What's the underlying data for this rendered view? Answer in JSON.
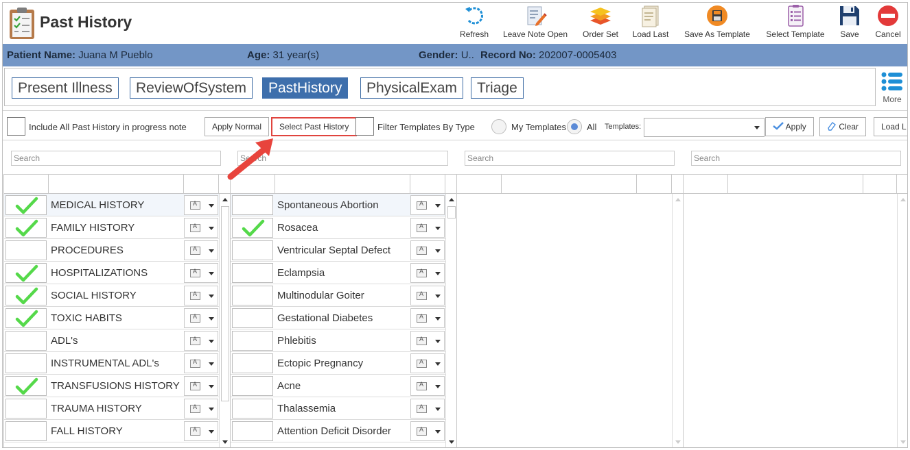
{
  "header": {
    "title": "Past History",
    "toolbar": [
      {
        "id": "refresh",
        "label": "Refresh"
      },
      {
        "id": "leave-note-open",
        "label": "Leave Note Open"
      },
      {
        "id": "order-set",
        "label": "Order Set"
      },
      {
        "id": "load-last",
        "label": "Load Last"
      },
      {
        "id": "save-as-template",
        "label": "Save As Template"
      },
      {
        "id": "select-template",
        "label": "Select Template"
      },
      {
        "id": "save",
        "label": "Save"
      },
      {
        "id": "cancel",
        "label": "Cancel"
      }
    ]
  },
  "patient": {
    "name_label": "Patient Name:",
    "name": "Juana M Pueblo",
    "age_label": "Age:",
    "age": "31 year(s)",
    "gender_label": "Gender:",
    "gender": "U..",
    "record_label": "Record No:",
    "record": "202007-0005403"
  },
  "tabs": [
    {
      "label": "Present Illness",
      "active": false
    },
    {
      "label": "ReviewOfSystem",
      "active": false
    },
    {
      "label": "PastHistory",
      "active": true
    },
    {
      "label": "PhysicalExam",
      "active": false
    },
    {
      "label": "Triage",
      "active": false
    }
  ],
  "more_label": "More",
  "filter": {
    "include_label": "Include All Past History in progress note",
    "apply_normal": "Apply Normal",
    "select_past_history": "Select Past History",
    "filter_by_type": "Filter Templates By Type",
    "my_templates": "My Templates",
    "all": "All",
    "templates_label": "Templates:",
    "templates_value": "",
    "apply": "Apply",
    "clear": "Clear",
    "load": "Load L"
  },
  "search_placeholder": "Search",
  "categories": [
    {
      "label": "MEDICAL HISTORY",
      "checked": true,
      "selected": true
    },
    {
      "label": "FAMILY HISTORY",
      "checked": true
    },
    {
      "label": "PROCEDURES",
      "checked": false
    },
    {
      "label": "HOSPITALIZATIONS",
      "checked": true
    },
    {
      "label": "SOCIAL HISTORY",
      "checked": true
    },
    {
      "label": "TOXIC HABITS",
      "checked": true
    },
    {
      "label": "ADL's",
      "checked": false
    },
    {
      "label": "INSTRUMENTAL ADL's",
      "checked": false
    },
    {
      "label": "TRANSFUSIONS HISTORY",
      "checked": true
    },
    {
      "label": "TRAUMA HISTORY",
      "checked": false
    },
    {
      "label": "FALL HISTORY",
      "checked": false
    }
  ],
  "conditions": [
    {
      "label": "Spontaneous Abortion",
      "checked": false,
      "selected": true
    },
    {
      "label": "Rosacea",
      "checked": true
    },
    {
      "label": "Ventricular Septal Defect",
      "checked": false
    },
    {
      "label": "Eclampsia",
      "checked": false
    },
    {
      "label": "Multinodular Goiter",
      "checked": false
    },
    {
      "label": "Gestational Diabetes",
      "checked": false
    },
    {
      "label": "Phlebitis",
      "checked": false
    },
    {
      "label": "Ectopic Pregnancy",
      "checked": false
    },
    {
      "label": "Acne",
      "checked": false
    },
    {
      "label": "Thalassemia",
      "checked": false
    },
    {
      "label": "Attention Deficit Disorder",
      "checked": false
    }
  ],
  "colors": {
    "patient_bar": "#7396c6",
    "active_tab": "#3e6fac",
    "check": "#55d94a",
    "highlight": "#e0443e"
  }
}
